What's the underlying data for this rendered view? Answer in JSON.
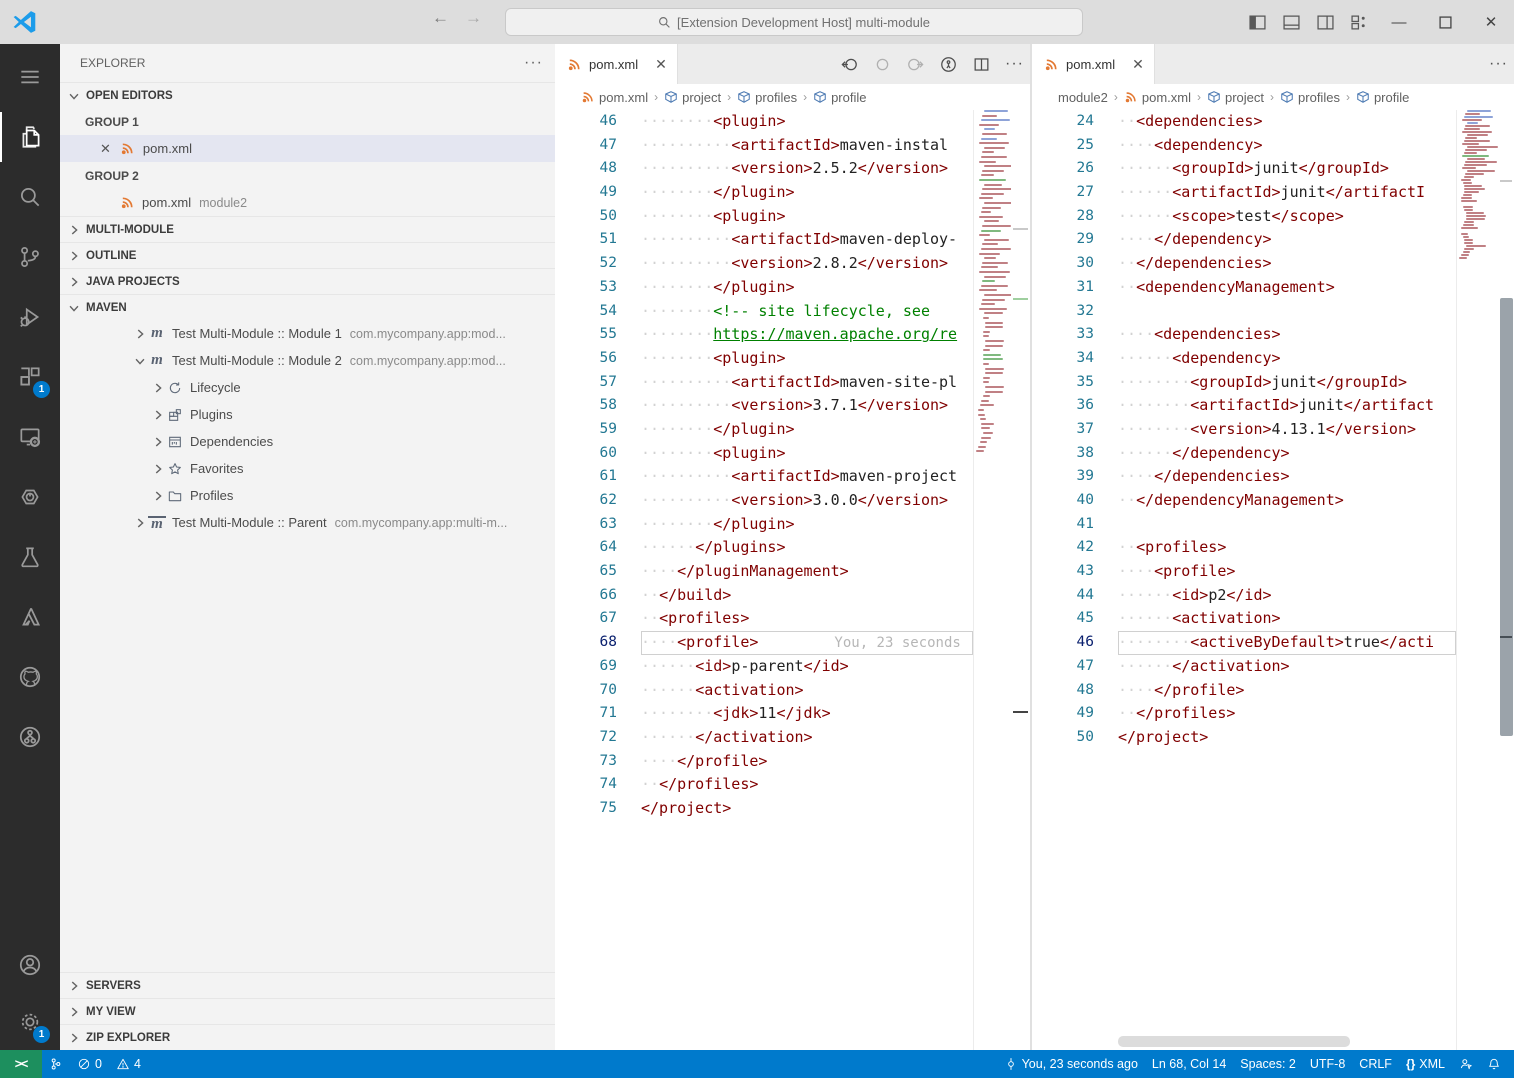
{
  "window": {
    "title": "[Extension Development Host] multi-module"
  },
  "colors": {
    "accent": "#007acc",
    "remote_green": "#1d8f5e",
    "status_blue": "#007acc",
    "xml_tag": "#800000",
    "xml_comment": "#008000",
    "line_number": "#237893",
    "active_line_number": "#0b216f",
    "xml_icon_orange": "#e37933",
    "badge": "#007acc"
  },
  "activity_bar": {
    "top": [
      {
        "name": "menu"
      },
      {
        "name": "explorer",
        "active": true
      },
      {
        "name": "search"
      },
      {
        "name": "source-control"
      },
      {
        "name": "run-debug"
      },
      {
        "name": "extensions",
        "badge": "1"
      },
      {
        "name": "remote-explorer"
      },
      {
        "name": "power"
      },
      {
        "name": "beaker"
      },
      {
        "name": "azure"
      },
      {
        "name": "github"
      },
      {
        "name": "gitlens"
      }
    ],
    "bottom": [
      {
        "name": "account"
      },
      {
        "name": "settings-gear",
        "badge": "1"
      }
    ]
  },
  "sidebar": {
    "title": "EXPLORER",
    "rows": [
      {
        "type": "section",
        "label": "OPEN EDITORS",
        "expanded": true
      },
      {
        "type": "group-label",
        "label": "GROUP 1"
      },
      {
        "type": "file",
        "label": "pom.xml",
        "desc": "",
        "selected": true,
        "closable": true
      },
      {
        "type": "group-label",
        "label": "GROUP 2"
      },
      {
        "type": "file",
        "label": "pom.xml",
        "desc": "module2"
      },
      {
        "type": "section",
        "label": "MULTI-MODULE",
        "expanded": false
      },
      {
        "type": "section",
        "label": "OUTLINE",
        "expanded": false
      },
      {
        "type": "section",
        "label": "JAVA PROJECTS",
        "expanded": false
      },
      {
        "type": "section",
        "label": "MAVEN",
        "expanded": true
      },
      {
        "type": "tree",
        "indent": 1,
        "chevron": "right",
        "icon": "maven",
        "label": "Test Multi-Module :: Module 1",
        "desc": "com.mycompany.app:mod..."
      },
      {
        "type": "tree",
        "indent": 1,
        "chevron": "down",
        "icon": "maven",
        "label": "Test Multi-Module :: Module 2",
        "desc": "com.mycompany.app:mod..."
      },
      {
        "type": "tree",
        "indent": 2,
        "chevron": "right",
        "icon": "lifecycle",
        "label": "Lifecycle"
      },
      {
        "type": "tree",
        "indent": 2,
        "chevron": "right",
        "icon": "plugins",
        "label": "Plugins"
      },
      {
        "type": "tree",
        "indent": 2,
        "chevron": "right",
        "icon": "dependencies",
        "label": "Dependencies"
      },
      {
        "type": "tree",
        "indent": 2,
        "chevron": "right",
        "icon": "star",
        "label": "Favorites"
      },
      {
        "type": "tree",
        "indent": 2,
        "chevron": "right",
        "icon": "folder",
        "label": "Profiles"
      },
      {
        "type": "tree",
        "indent": 1,
        "chevron": "right",
        "icon": "maven-parent",
        "label": "Test Multi-Module :: Parent",
        "desc": "com.mycompany.app:multi-m..."
      }
    ],
    "bottom_sections": [
      "SERVERS",
      "MY VIEW",
      "ZIP EXPLORER"
    ]
  },
  "editors": [
    {
      "tab": "pom.xml",
      "breadcrumbs": [
        {
          "label": "pom.xml",
          "icon": "xml"
        },
        {
          "label": "project",
          "icon": "cube"
        },
        {
          "label": "profiles",
          "icon": "cube"
        },
        {
          "label": "profile",
          "icon": "cube"
        }
      ],
      "total_lines": 75,
      "lines": [
        {
          "n": 46,
          "t": "        <plugin>"
        },
        {
          "n": 47,
          "t": "          <artifactId>maven-instal"
        },
        {
          "n": 48,
          "t": "          <version>2.5.2</version>"
        },
        {
          "n": 49,
          "t": "        </plugin>"
        },
        {
          "n": 50,
          "t": "        <plugin>"
        },
        {
          "n": 51,
          "t": "          <artifactId>maven-deploy-"
        },
        {
          "n": 52,
          "t": "          <version>2.8.2</version>"
        },
        {
          "n": 53,
          "t": "        </plugin>"
        },
        {
          "n": 54,
          "t": "        <!-- site lifecycle, see",
          "k": "comment"
        },
        {
          "n": 55,
          "t": "        https://maven.apache.org/re",
          "k": "link"
        },
        {
          "n": 56,
          "t": "        <plugin>"
        },
        {
          "n": 57,
          "t": "          <artifactId>maven-site-pl"
        },
        {
          "n": 58,
          "t": "          <version>3.7.1</version>"
        },
        {
          "n": 59,
          "t": "        </plugin>"
        },
        {
          "n": 60,
          "t": "        <plugin>"
        },
        {
          "n": 61,
          "t": "          <artifactId>maven-project"
        },
        {
          "n": 62,
          "t": "          <version>3.0.0</version>"
        },
        {
          "n": 63,
          "t": "        </plugin>"
        },
        {
          "n": 64,
          "t": "      </plugins>"
        },
        {
          "n": 65,
          "t": "    </pluginManagement>"
        },
        {
          "n": 66,
          "t": "  </build>"
        },
        {
          "n": 67,
          "t": "  <profiles>"
        },
        {
          "n": 68,
          "t": "    <profile>",
          "current": true,
          "blame": "You, 23 seconds"
        },
        {
          "n": 69,
          "t": "      <id>p-parent</id>"
        },
        {
          "n": 70,
          "t": "      <activation>"
        },
        {
          "n": 71,
          "t": "        <jdk>11</jdk>"
        },
        {
          "n": 72,
          "t": "      </activation>"
        },
        {
          "n": 73,
          "t": "    </profile>"
        },
        {
          "n": 74,
          "t": "  </profiles>"
        },
        {
          "n": 75,
          "t": "</project>"
        }
      ]
    },
    {
      "tab": "pom.xml",
      "breadcrumbs": [
        {
          "label": "module2"
        },
        {
          "label": "pom.xml",
          "icon": "xml"
        },
        {
          "label": "project",
          "icon": "cube"
        },
        {
          "label": "profiles",
          "icon": "cube"
        },
        {
          "label": "profile",
          "icon": "cube"
        }
      ],
      "total_lines": 50,
      "lines": [
        {
          "n": 24,
          "t": "  <dependencies>"
        },
        {
          "n": 25,
          "t": "    <dependency>"
        },
        {
          "n": 26,
          "t": "      <groupId>junit</groupId>"
        },
        {
          "n": 27,
          "t": "      <artifactId>junit</artifactI"
        },
        {
          "n": 28,
          "t": "      <scope>test</scope>"
        },
        {
          "n": 29,
          "t": "    </dependency>"
        },
        {
          "n": 30,
          "t": "  </dependencies>"
        },
        {
          "n": 31,
          "t": "  <dependencyManagement>"
        },
        {
          "n": 32,
          "t": ""
        },
        {
          "n": 33,
          "t": "    <dependencies>"
        },
        {
          "n": 34,
          "t": "      <dependency>"
        },
        {
          "n": 35,
          "t": "        <groupId>junit</groupId>"
        },
        {
          "n": 36,
          "t": "        <artifactId>junit</artifact"
        },
        {
          "n": 37,
          "t": "        <version>4.13.1</version>"
        },
        {
          "n": 38,
          "t": "      </dependency>"
        },
        {
          "n": 39,
          "t": "    </dependencies>"
        },
        {
          "n": 40,
          "t": "  </dependencyManagement>"
        },
        {
          "n": 41,
          "t": ""
        },
        {
          "n": 42,
          "t": "  <profiles>"
        },
        {
          "n": 43,
          "t": "    <profile>"
        },
        {
          "n": 44,
          "t": "      <id>p2</id>"
        },
        {
          "n": 45,
          "t": "      <activation>"
        },
        {
          "n": 46,
          "t": "        <activeByDefault>true</acti",
          "current": true
        },
        {
          "n": 47,
          "t": "      </activation>"
        },
        {
          "n": 48,
          "t": "    </profile>"
        },
        {
          "n": 49,
          "t": "  </profiles>"
        },
        {
          "n": 50,
          "t": "</project>"
        }
      ]
    }
  ],
  "status_bar": {
    "remote_label": "><",
    "left": [
      {
        "icon": "branch",
        "text": ""
      },
      {
        "icon": "error",
        "text": "0"
      },
      {
        "icon": "warning",
        "text": "4"
      }
    ],
    "right": [
      {
        "icon": "commit",
        "text": "You, 23 seconds ago",
        "name": "blame-status"
      },
      {
        "text": "Ln 68, Col 14",
        "name": "cursor-position"
      },
      {
        "text": "Spaces: 2",
        "name": "indentation"
      },
      {
        "text": "UTF-8",
        "name": "encoding"
      },
      {
        "text": "CRLF",
        "name": "eol"
      },
      {
        "icon": "braces",
        "text": "XML",
        "name": "language-mode"
      },
      {
        "icon": "feedback",
        "text": "",
        "name": "feedback"
      },
      {
        "icon": "bell",
        "text": "",
        "name": "notifications"
      }
    ]
  }
}
